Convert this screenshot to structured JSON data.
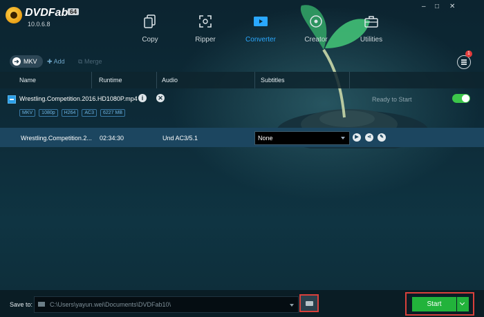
{
  "app": {
    "name": "DVDFab",
    "bits": "64",
    "version": "10.0.6.8"
  },
  "nav": {
    "items": [
      {
        "label": "Copy",
        "icon": "copy-icon"
      },
      {
        "label": "Ripper",
        "icon": "ripper-icon"
      },
      {
        "label": "Converter",
        "icon": "converter-icon"
      },
      {
        "label": "Creator",
        "icon": "creator-icon"
      },
      {
        "label": "Utilities",
        "icon": "utilities-icon"
      }
    ],
    "active": "Converter",
    "active_color": "#2aa8ff"
  },
  "window_controls": {
    "minimize": "–",
    "restore": "□",
    "close": "✕"
  },
  "toolbar": {
    "profile_label": "MKV",
    "add_label": "Add",
    "merge_label": "Merge",
    "notification_count": "1"
  },
  "table": {
    "headers": [
      "Name",
      "Runtime",
      "Audio",
      "Subtitles"
    ]
  },
  "title": {
    "file_name": "Wrestling.Competition.2016.HD1080P.mp4",
    "tags": [
      "MKV",
      "1080p",
      "H264",
      "AC3",
      "6227 MB"
    ],
    "status": "Ready to Start"
  },
  "stream": {
    "name": "Wrestling.Competition.2...",
    "runtime": "02:34:30",
    "audio": "Und AC3/5.1",
    "subtitle": "None"
  },
  "bottom": {
    "save_label": "Save to:",
    "path": "C:\\Users\\yayun.wei\\Documents\\DVDFab10\\",
    "start_label": "Start"
  },
  "colors": {
    "start": "#22b33b",
    "highlight_frame": "#d9403b",
    "toggle_on": "#3cc64a"
  }
}
